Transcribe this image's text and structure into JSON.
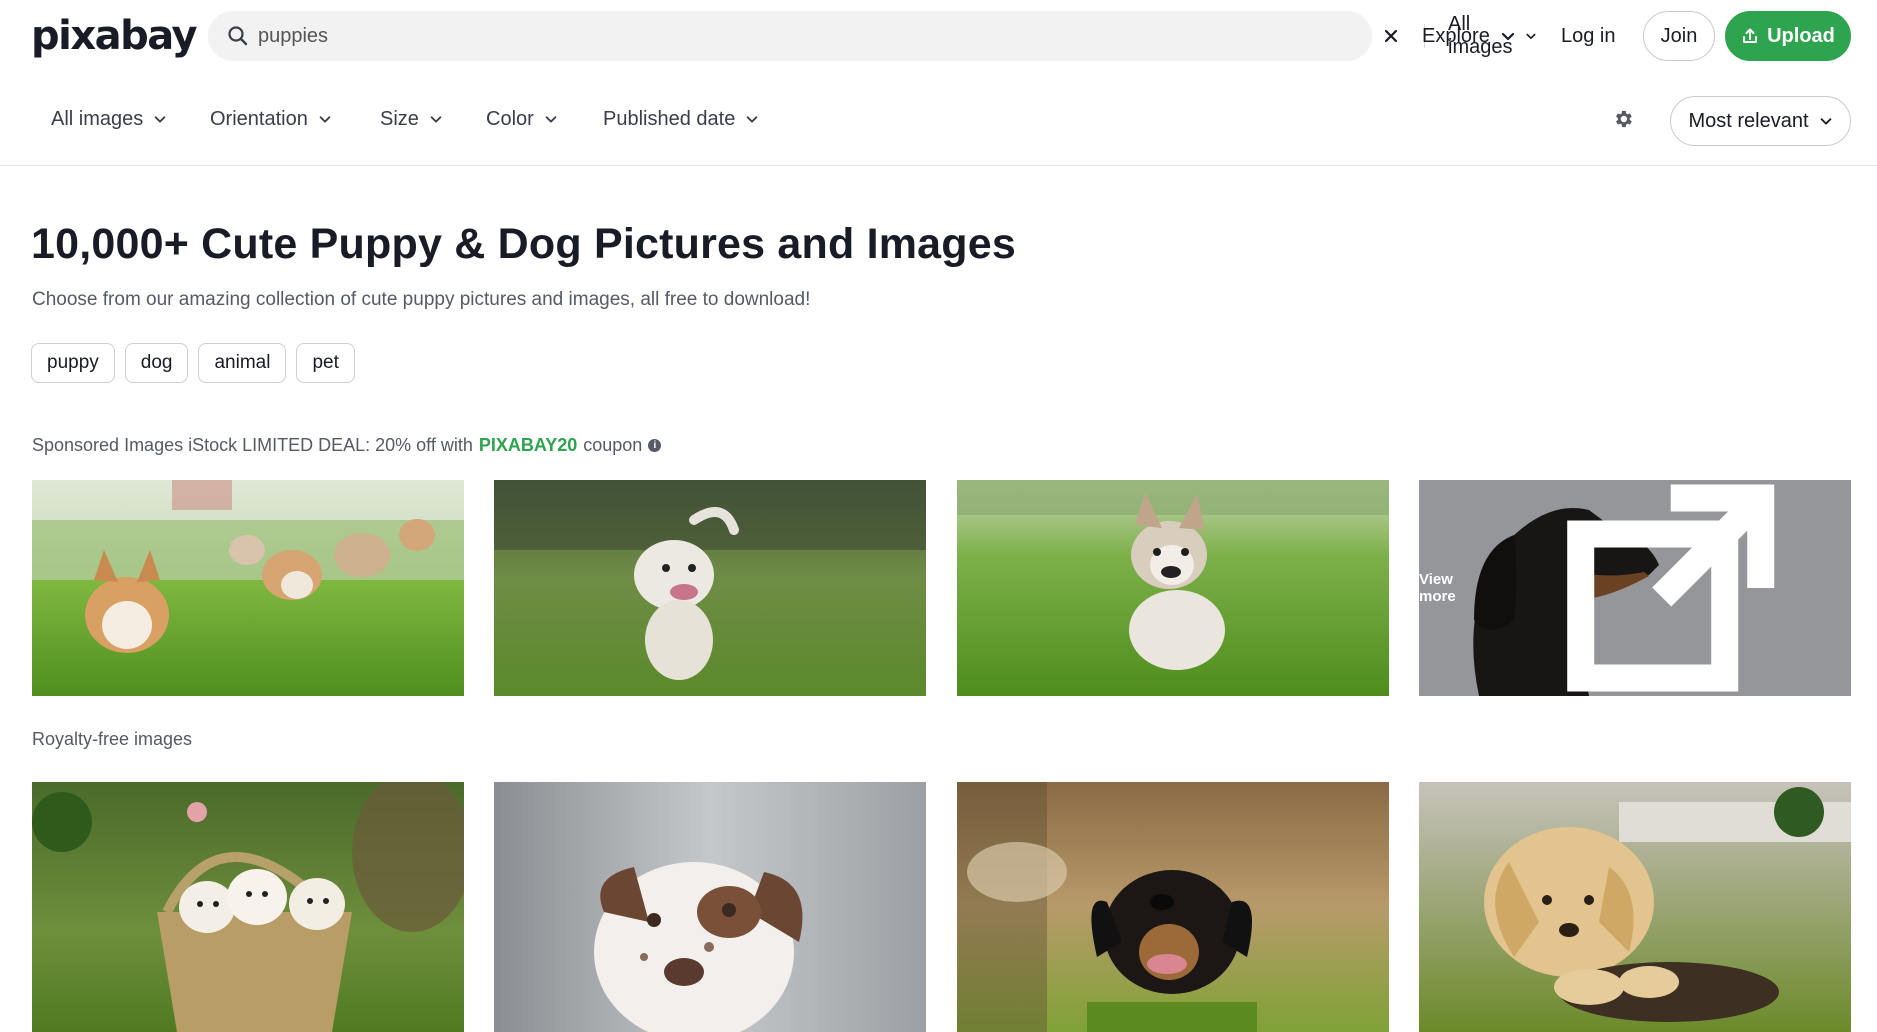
{
  "header": {
    "logo_text": "pixabay",
    "search": {
      "value": "puppies",
      "placeholder": "Search for all images on Pixabay"
    },
    "scope_label": "All images",
    "explore_label": "Explore",
    "login_label": "Log in",
    "join_label": "Join",
    "upload_label": "Upload"
  },
  "filters": {
    "items": [
      "All images",
      "Orientation",
      "Size",
      "Color",
      "Published date"
    ],
    "sort_label": "Most relevant"
  },
  "main": {
    "title": "10,000+ Cute Puppy & Dog Pictures and Images",
    "subtitle": "Choose from our amazing collection of cute puppy pictures and images, all free to download!",
    "tags": [
      "puppy",
      "dog",
      "animal",
      "pet"
    ],
    "sponsored": {
      "text_prefix": "Sponsored Images iStock LIMITED DEAL: 20% off with",
      "code": "PIXABAY20",
      "text_suffix": "coupon"
    },
    "view_more_label": "View more",
    "royalty_free_label": "Royalty-free images"
  },
  "colors": {
    "accent": "#2ea44f",
    "text": "#191b26",
    "muted": "#555a66"
  }
}
